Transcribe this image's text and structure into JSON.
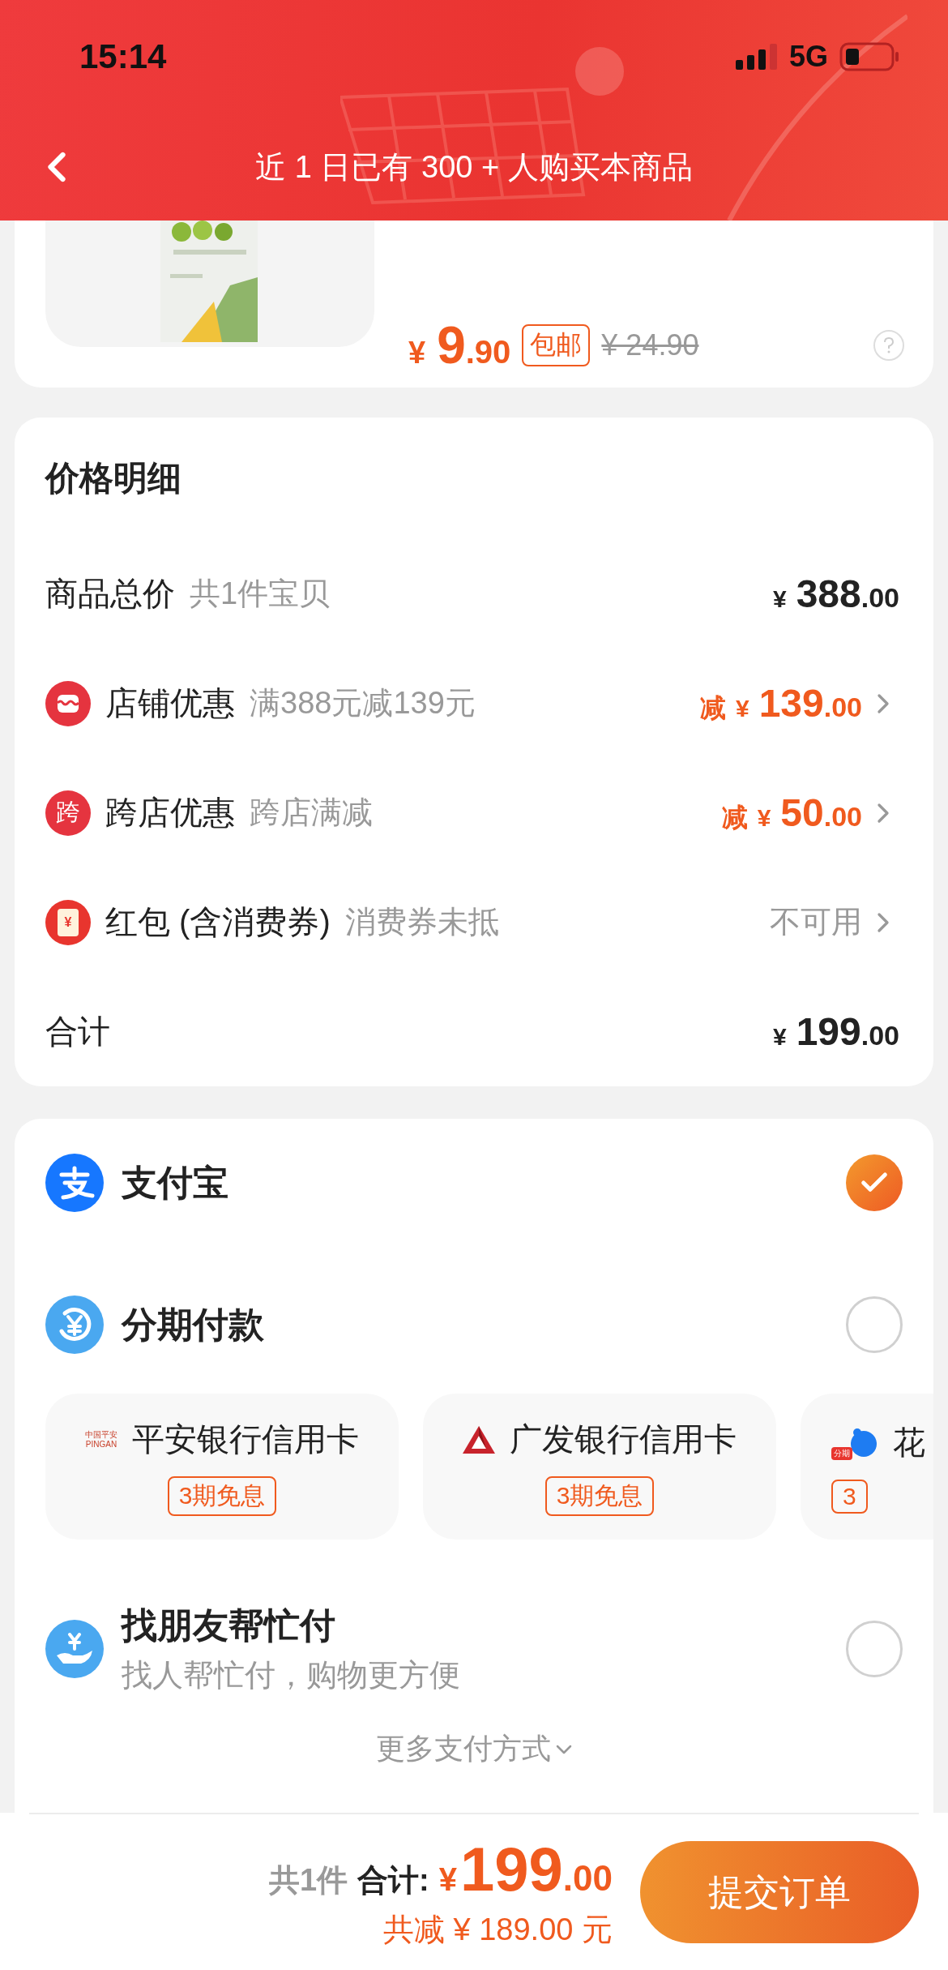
{
  "status_bar": {
    "time": "15:14",
    "network": "5G"
  },
  "header": {
    "title": "近 1 日已有 300 + 人购买本商品"
  },
  "product": {
    "currency": "¥",
    "price_integer": "9",
    "price_decimals": ".90",
    "shipping_tag": "包邮",
    "original_price": "¥ 24.90"
  },
  "price_detail": {
    "title": "价格明细",
    "rows": [
      {
        "kind": "amount",
        "label": "商品总价",
        "note": "共1件宝贝",
        "currency": "¥",
        "integer": "388",
        "decimals": ".00",
        "arrow": false
      },
      {
        "kind": "discount",
        "label": "店铺优惠",
        "note": "满388元减139元",
        "prefix": "减",
        "currency": "¥",
        "integer": "139",
        "decimals": ".00",
        "arrow": true
      },
      {
        "kind": "discount",
        "icon_text": "跨",
        "label": "跨店优惠",
        "note": "跨店满减",
        "prefix": "减",
        "currency": "¥",
        "integer": "50",
        "decimals": ".00",
        "arrow": true
      },
      {
        "kind": "status",
        "icon_text": "¥",
        "label": "红包 (含消费券)",
        "note": "消费券未抵",
        "value": "不可用",
        "arrow": true
      },
      {
        "kind": "amount",
        "label": "合计",
        "currency": "¥",
        "integer": "199",
        "decimals": ".00",
        "arrow": false
      }
    ]
  },
  "payment": {
    "methods": [
      {
        "kind": "simple",
        "name": "支付宝",
        "selected": true
      },
      {
        "kind": "installment",
        "name": "分期付款",
        "selected": false,
        "options": [
          {
            "logo_lines": [
              "中国平安",
              "PINGAN"
            ],
            "bank": "平安银行信用卡",
            "tag": "3期免息"
          },
          {
            "bank": "广发银行信用卡",
            "tag": "3期免息"
          },
          {
            "logo_badge": "分期",
            "bank": "花",
            "tag": "3"
          }
        ]
      },
      {
        "kind": "friend",
        "name": "找朋友帮忙付",
        "subtitle": "找人帮忙付，购物更方便",
        "selected": false
      }
    ],
    "more": "更多支付方式"
  },
  "bottom_bar": {
    "count": "共1件",
    "total_label": "合计:",
    "currency": "¥",
    "integer": "199",
    "decimals": ".00",
    "savings": "共减 ¥ 189.00 元",
    "submit": "提交订单"
  }
}
